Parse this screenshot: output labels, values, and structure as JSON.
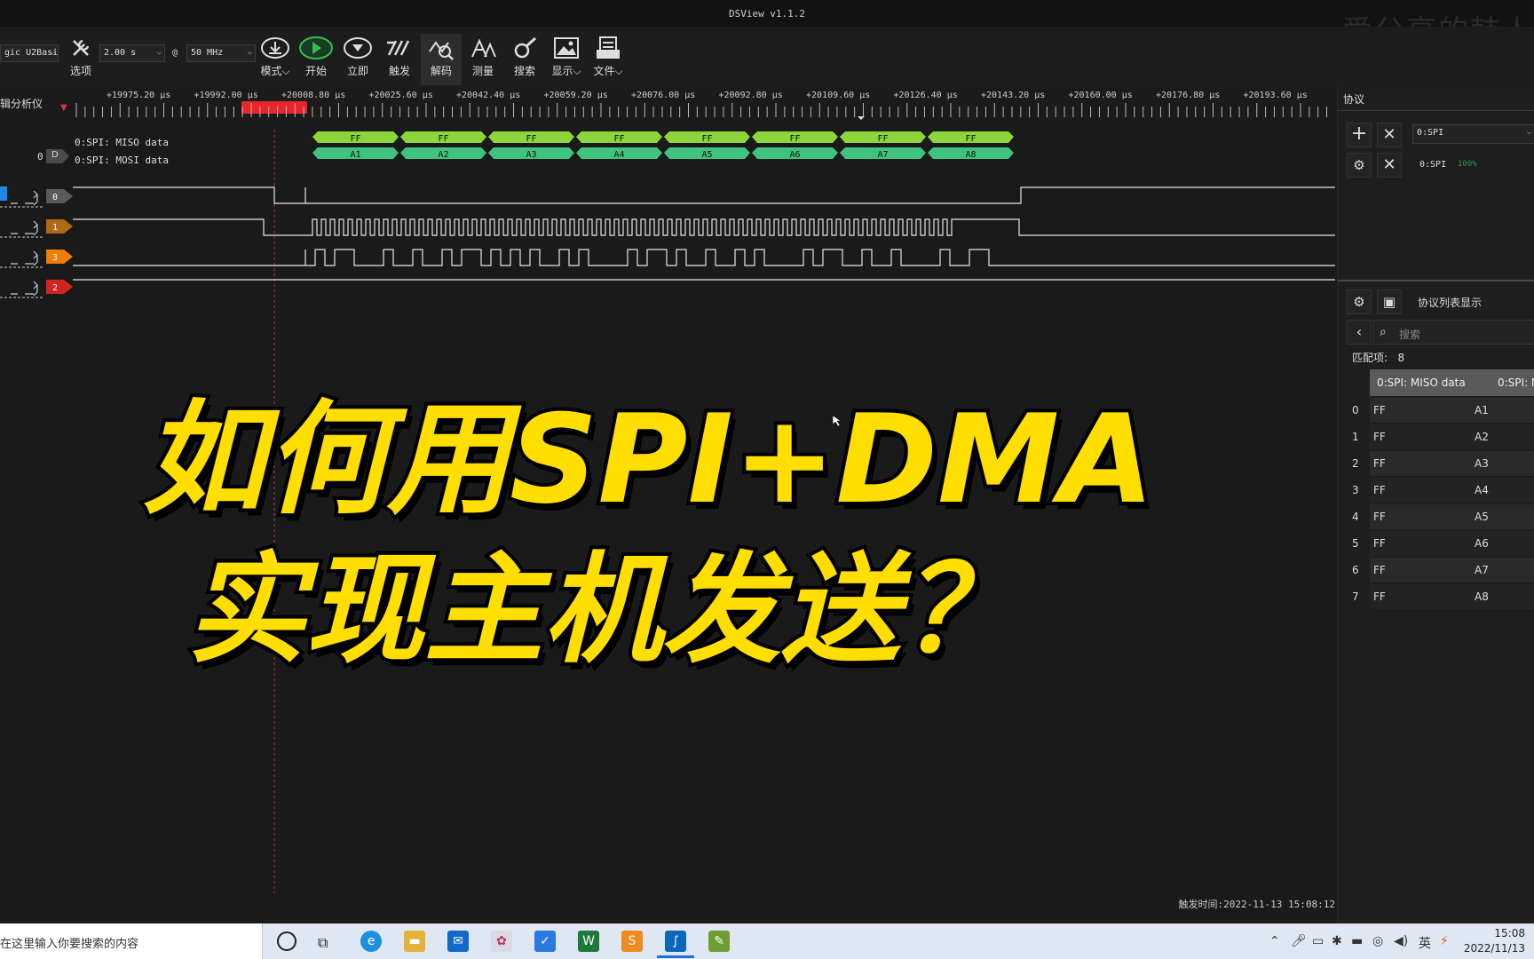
{
  "app": {
    "title": "DSView v1.1.2",
    "watermark": "爱分享的韩人"
  },
  "toolbar": {
    "device": "gic U2Basi",
    "sample_time": "2.00 s",
    "at": "@",
    "sample_rate": "50 MHz",
    "buttons": [
      {
        "label": "选项",
        "icon": "wrench-icon"
      },
      {
        "label": "模式",
        "icon": "download-icon"
      },
      {
        "label": "开始",
        "icon": "play-icon"
      },
      {
        "label": "立即",
        "icon": "instant-icon"
      },
      {
        "label": "触发",
        "icon": "trigger-icon"
      },
      {
        "label": "解码",
        "icon": "decode-icon"
      },
      {
        "label": "测量",
        "icon": "measure-icon"
      },
      {
        "label": "搜索",
        "icon": "search-icon"
      },
      {
        "label": "显示",
        "icon": "display-icon"
      },
      {
        "label": "文件",
        "icon": "file-icon"
      }
    ]
  },
  "ruler": {
    "left_label": "辑分析仪",
    "ticks": [
      "+19975.20 μs",
      "+19992.00 μs",
      "+20008.80 μs",
      "+20025.60 μs",
      "+20042.40 μs",
      "+20059.20 μs",
      "+20076.00 μs",
      "+20092.80 μs",
      "+20109.60 μs",
      "+20126.40 μs",
      "+20143.20 μs",
      "+20160.00 μs",
      "+20176.80 μs",
      "+20193.60 μs"
    ]
  },
  "decoder": {
    "row_index": "0",
    "badge": "D",
    "miso_label": "0:SPI: MISO data",
    "mosi_label": "0:SPI: MOSI data",
    "miso": [
      "FF",
      "FF",
      "FF",
      "FF",
      "FF",
      "FF",
      "FF",
      "FF"
    ],
    "mosi": [
      "A1",
      "A2",
      "A3",
      "A4",
      "A5",
      "A6",
      "A7",
      "A8"
    ],
    "miso_color": "#8cd63c",
    "mosi_color": "#3fc37f"
  },
  "channels": [
    {
      "id": "0",
      "color": "#5a5a5a"
    },
    {
      "id": "1",
      "color": "#b06a14"
    },
    {
      "id": "3",
      "color": "#ef7d0a"
    },
    {
      "id": "2",
      "color": "#d3231e"
    }
  ],
  "overlay": {
    "line1": "如何用SPI+DMA",
    "line2": "实现主机发送？",
    "color": "#ffde00"
  },
  "right_panel": {
    "title": "协议",
    "protocol_select": "0:SPI",
    "protocol_entry": "0:SPI",
    "progress": "100%",
    "list_title": "协议列表显示",
    "search_placeholder": "搜索",
    "match_label": "匹配项:",
    "match_count": "8",
    "columns": [
      "0:SPI: MISO data",
      "0:SPI: M"
    ],
    "rows": [
      {
        "idx": "0",
        "miso": "FF",
        "mosi": "A1"
      },
      {
        "idx": "1",
        "miso": "FF",
        "mosi": "A2"
      },
      {
        "idx": "2",
        "miso": "FF",
        "mosi": "A3"
      },
      {
        "idx": "3",
        "miso": "FF",
        "mosi": "A4"
      },
      {
        "idx": "4",
        "miso": "FF",
        "mosi": "A5"
      },
      {
        "idx": "5",
        "miso": "FF",
        "mosi": "A6"
      },
      {
        "idx": "6",
        "miso": "FF",
        "mosi": "A7"
      },
      {
        "idx": "7",
        "miso": "FF",
        "mosi": "A8"
      }
    ]
  },
  "status": {
    "trigger_time": "触发时间:2022-11-13 15:08:12"
  },
  "taskbar": {
    "search_text": "在这里输入你要搜索的内容",
    "time": "15:08",
    "date": "2022/11/13"
  }
}
